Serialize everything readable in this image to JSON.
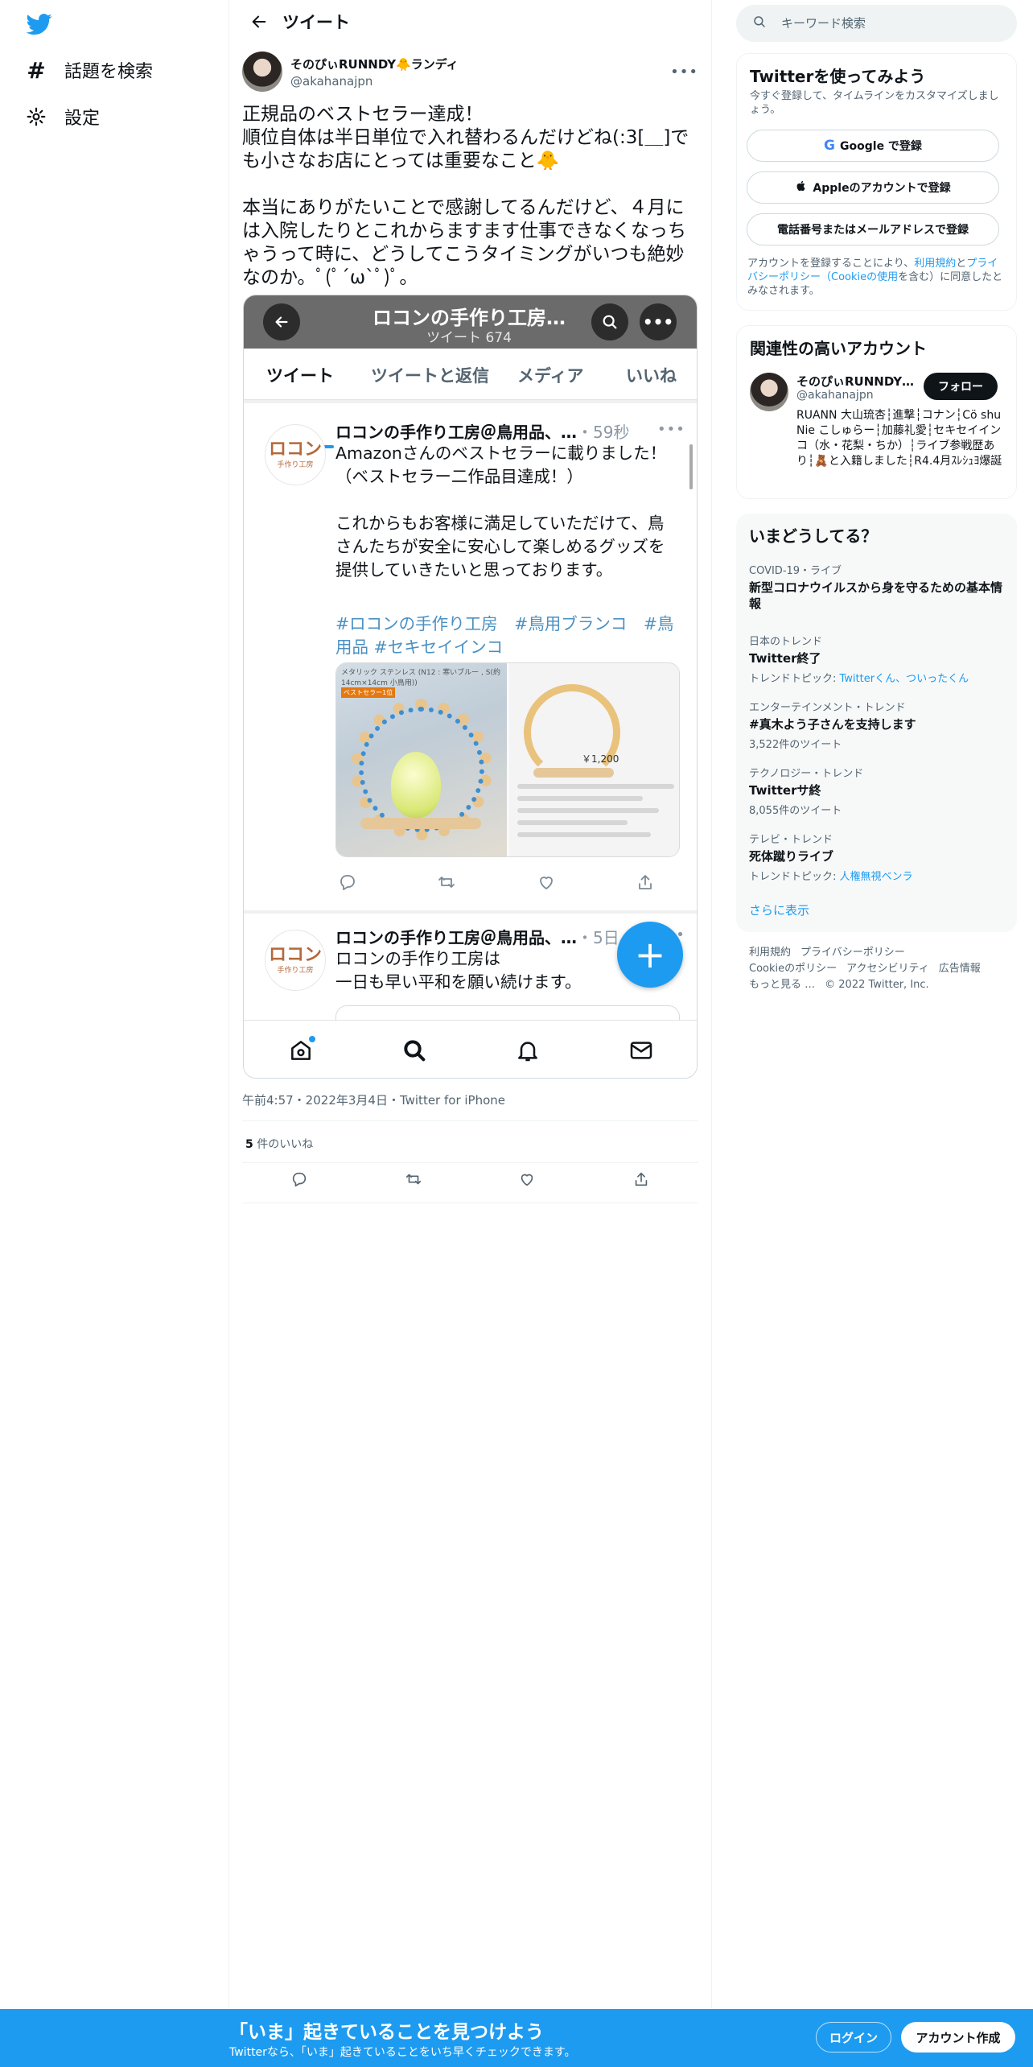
{
  "nav": {
    "explore_label": "話題を検索",
    "settings_label": "設定"
  },
  "header": {
    "title": "ツイート"
  },
  "tweet": {
    "display_name": "そのぴぃRUNNDY🐥ランディ",
    "handle": "@akahanajpn",
    "text": "正規品のベストセラー達成！\n順位自体は半日単位で入れ替わるんだけどね(:3[＿]でも小さなお店にとっては重要なこと🐥\n\n本当にありがたいことで感謝してるんだけど、４月には入院したりとこれからますます仕事できなくなっちゃうって時に、どうしてこうタイミングがいつも絶妙なのか。ﾟ(ﾟ´ω`ﾟ)ﾟ。",
    "meta": "午前4:57・2022年3月4日・Twitter for iPhone",
    "likes_count": "5",
    "likes_label": " 件のいいね"
  },
  "screenshot": {
    "profile_title": "ロコンの手作り工房…",
    "tweet_count": "ツイート 674",
    "tabs": [
      "ツイート",
      "ツイートと返信",
      "メディア",
      "いいね"
    ],
    "post1": {
      "avatar_text": "ロコン",
      "avatar_sub": "手作り工房",
      "name": "ロコンの手作り工房＠鳥用品、…",
      "time": "・59秒",
      "body": "Amazonさんのベストセラーに載りました！（ベストセラー二作品目達成！）\n\nこれからもお客様に満足していただけて、鳥さんたちが安全に安心して楽しめるグッズを提供していきたいと思っております。",
      "hashtags": "#ロコンの手作り工房　#鳥用ブランコ　#鳥用品 #セキセイインコ",
      "media_caption": "メタリック ステンレス (N12 : 寒いブルー , S(約14cm×14cm 小鳥用))",
      "media_badge": "ベストセラー1位",
      "media_price": "￥1,200"
    },
    "post2": {
      "avatar_text": "ロコン",
      "avatar_sub": "手作り工房",
      "name": "ロコンの手作り工房＠鳥用品、…",
      "time": "・5日",
      "body": "ロコンの手作り工房は\n一日も早い平和を願い続けます。"
    }
  },
  "search": {
    "placeholder": "キーワード検索"
  },
  "signup_card": {
    "title": "Twitterを使ってみよう",
    "subtitle": "今すぐ登録して、タイムラインをカスタマイズしましょう。",
    "google_label": "Google で登録",
    "apple_label": "Appleのアカウントで登録",
    "phone_label": "電話番号またはメールアドレスで登録",
    "terms_prefix": "アカウントを登録することにより、",
    "terms_link1": "利用規約",
    "terms_mid": "と",
    "terms_link2": "プライバシーポリシー（Cookieの使用",
    "terms_suffix": "を含む）に同意したとみなされます。"
  },
  "related_card": {
    "title": "関連性の高いアカウント",
    "name": "そのぴぃRUNNDY…",
    "handle": "@akahanajpn",
    "bio": "RUANN 大山琉杏┆進撃┆コナン┆Cö shu Nie こしゅらー┆加藤礼愛┆セキセイインコ（水・花梨・ちか）┆ライブ参戦歴あり┆🧸と入籍しました┆R4.4月ｽﾚｼｭﾖ爆誕",
    "follow_label": "フォロー"
  },
  "trends_card": {
    "title": "いまどうしてる？",
    "items": [
      {
        "category": "COVID-19・ライブ",
        "name": "新型コロナウイルスから身を守るための基本情報",
        "sub": ""
      },
      {
        "category": "日本のトレンド",
        "name": "Twitter終了",
        "sub": "トレンドトピック: ",
        "sub_link": "Twitterくん、ついったくん"
      },
      {
        "category": "エンターテインメント・トレンド",
        "name": "#真木よう子さんを支持します",
        "sub": "3,522件のツイート"
      },
      {
        "category": "テクノロジー・トレンド",
        "name": "Twitterサ終",
        "sub": "8,055件のツイート"
      },
      {
        "category": "テレビ・トレンド",
        "name": "死体蹴りライブ",
        "sub": "トレンドトピック: ",
        "sub_link": "人権無視ベンラ"
      }
    ],
    "show_more": "さらに表示"
  },
  "footer": {
    "links": [
      "利用規約",
      "プライバシーポリシー",
      "Cookieのポリシー",
      "アクセシビリティ",
      "広告情報",
      "もっと見る …"
    ],
    "copyright": "© 2022 Twitter, Inc."
  },
  "banner": {
    "title": "「いま」起きていることを見つけよう",
    "subtitle": "Twitterなら、「いま」起きていることをいち早くチェックできます。",
    "login_label": "ログイン",
    "signup_label": "アカウント作成"
  },
  "colors": {
    "accent": "#1d9bf0",
    "text": "#0f1419",
    "muted": "#536471"
  }
}
